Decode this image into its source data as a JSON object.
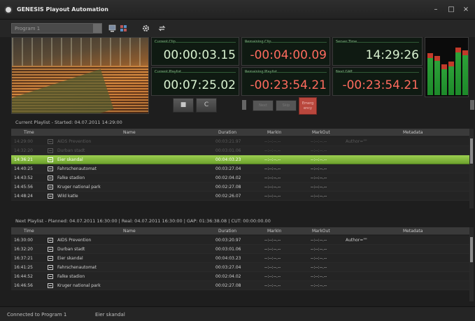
{
  "window": {
    "title": "GENESIS Playout Automation",
    "controls": [
      "–",
      "□",
      "×"
    ]
  },
  "toolbar": {
    "program_select": "Program 1",
    "icons": [
      "monitor-icon",
      "grid-icon",
      "gear-icon",
      "arrows-icon"
    ]
  },
  "clocks": {
    "current_clip": {
      "label": "Current Clip",
      "value": "00:00:03.15"
    },
    "remaining_clip": {
      "label": "Remaining Clip",
      "value": "-00:04:00.09"
    },
    "server_time": {
      "label": "Server Time",
      "value": "14:29:26"
    },
    "current_playlist": {
      "label": "Current Playlist",
      "value": "00:07:25.02"
    },
    "remaining_playlist": {
      "label": "Remaining Playlist",
      "value": "-00:23:54.21"
    },
    "next_gap": {
      "label": "Next GAP",
      "value": "-00:23:54.21"
    }
  },
  "controls": {
    "stop": "■",
    "loop": "C",
    "small1": "Next",
    "small2": "Skip",
    "emergency": "Emerg ency"
  },
  "levels": [
    0.75,
    0.7,
    0.55,
    0.6,
    0.85,
    0.8
  ],
  "current_playlist": {
    "title": "Current Playlist - Started: 04.07.2011 14:29:00",
    "headers": {
      "time": "Time",
      "name": "Name",
      "duration": "Duration",
      "markin": "MarkIn",
      "markout": "MarkOut",
      "metadata": "Metadata"
    },
    "rows": [
      {
        "time": "14:29:00",
        "name": "AIDS Prevention",
        "duration": "00:03:21.97",
        "markin": "--:--:--.--",
        "markout": "--:--:--.--",
        "metadata": "Author=\"\""
      },
      {
        "time": "14:32:20",
        "name": "Durban stadt",
        "duration": "00:03:01.06",
        "markin": "--:--:--.--",
        "markout": "--:--:--.--",
        "metadata": ""
      },
      {
        "time": "14:36:21",
        "name": "Eier skandal",
        "duration": "00:04:03.23",
        "markin": "--:--:--.--",
        "markout": "--:--:--.--",
        "metadata": ""
      },
      {
        "time": "14:40:25",
        "name": "Fahrschenautomat",
        "duration": "00:03:27.04",
        "markin": "--:--:--.--",
        "markout": "--:--:--.--",
        "metadata": ""
      },
      {
        "time": "14:43:52",
        "name": "Falke stadion",
        "duration": "00:02:04.02",
        "markin": "--:--:--.--",
        "markout": "--:--:--.--",
        "metadata": ""
      },
      {
        "time": "14:45:56",
        "name": "Kruger national park",
        "duration": "00:02:27.08",
        "markin": "--:--:--.--",
        "markout": "--:--:--.--",
        "metadata": ""
      },
      {
        "time": "14:48:24",
        "name": "Wild katle",
        "duration": "00:02:26.07",
        "markin": "--:--:--.--",
        "markout": "--:--:--.--",
        "metadata": ""
      }
    ]
  },
  "next_playlist": {
    "title": "Next Playlist - Planned: 04.07.2011 16:30:00 | Real: 04.07.2011 16:30:00 | GAP: 01:36:38.08 | CUT: 00:00:00.00",
    "headers": {
      "time": "Time",
      "name": "Name",
      "duration": "Duration",
      "markin": "MarkIn",
      "markout": "MarkOut",
      "metadata": "Metadata"
    },
    "rows": [
      {
        "time": "16:30:00",
        "name": "AIDS Prevention",
        "duration": "00:03:20.97",
        "markin": "--:--:--.--",
        "markout": "--:--:--.--",
        "metadata": "Author=\"\""
      },
      {
        "time": "16:32:20",
        "name": "Durban stadt",
        "duration": "00:03:01.06",
        "markin": "--:--:--.--",
        "markout": "--:--:--.--",
        "metadata": ""
      },
      {
        "time": "16:37:21",
        "name": "Eier skandal",
        "duration": "00:04:03.23",
        "markin": "--:--:--.--",
        "markout": "--:--:--.--",
        "metadata": ""
      },
      {
        "time": "16:41:25",
        "name": "Fahrschenautomat",
        "duration": "00:03:27.04",
        "markin": "--:--:--.--",
        "markout": "--:--:--.--",
        "metadata": ""
      },
      {
        "time": "16:44:52",
        "name": "Falke stadion",
        "duration": "00:02:04.02",
        "markin": "--:--:--.--",
        "markout": "--:--:--.--",
        "metadata": ""
      },
      {
        "time": "16:46:56",
        "name": "Kruger national park",
        "duration": "00:02:27.08",
        "markin": "--:--:--.--",
        "markout": "--:--:--.--",
        "metadata": ""
      }
    ]
  },
  "status": {
    "connection": "Connected to Program 1",
    "current_clip": "Eier skandal"
  },
  "colors": {
    "active_row": "#8bc043",
    "remaining_red": "#ff6b5e",
    "emergency": "#b9473d"
  }
}
